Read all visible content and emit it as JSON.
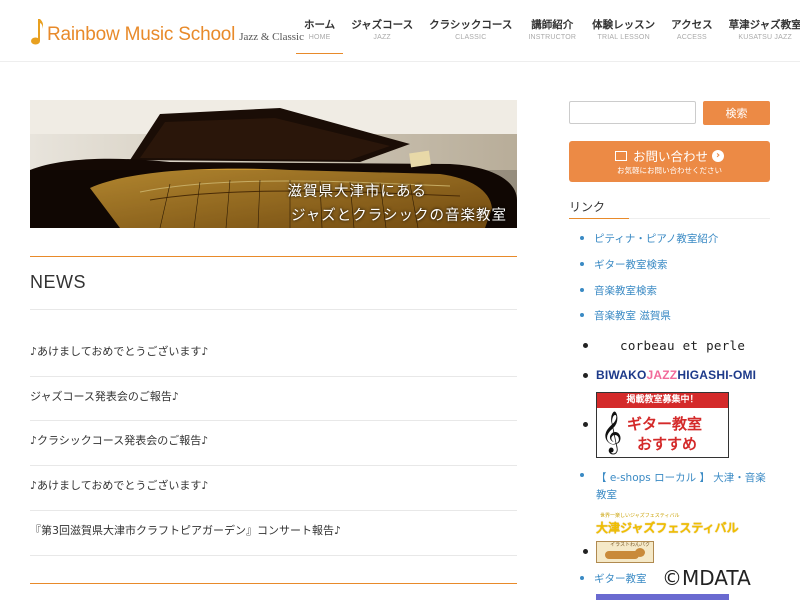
{
  "logo": {
    "main": "Rainbow Music School",
    "sub": "Jazz & Classic"
  },
  "nav": [
    {
      "jp": "ホーム",
      "en": "HOME",
      "active": true
    },
    {
      "jp": "ジャズコース",
      "en": "JAZZ"
    },
    {
      "jp": "クラシックコース",
      "en": "CLASSIC"
    },
    {
      "jp": "講師紹介",
      "en": "INSTRUCTOR"
    },
    {
      "jp": "体験レッスン",
      "en": "TRIAL LESSON"
    },
    {
      "jp": "アクセス",
      "en": "ACCESS"
    },
    {
      "jp": "草津ジャズ教室",
      "en": "KUSATSU JAZZ"
    }
  ],
  "hero": {
    "line1": "滋賀県大津市にある",
    "line2": "ジャズとクラシックの音楽教室"
  },
  "news": {
    "title": "NEWS",
    "items": [
      "♪あけましておめでとうございます♪",
      "ジャズコース発表会のご報告♪",
      "♪クラシックコース発表会のご報告♪",
      "♪あけましておめでとうございます♪",
      "『第3回滋賀県大津市クラフトピアガーデン』コンサート報告♪"
    ]
  },
  "sidebar": {
    "search_placeholder": "",
    "search_button": "検索",
    "contact_main": "お問い合わせ",
    "contact_sub": "お気軽にお問い合わせください",
    "links_title": "リンク",
    "links": [
      "ピティナ・ピアノ教室紹介",
      "ギター教室検索",
      "音楽教室検索",
      "音楽教室 滋賀県"
    ],
    "corbeau": "corbeau et perle",
    "biwako_a": "BIWAKO",
    "biwako_b": "JAZZ",
    "biwako_c": "HIGASHI-OMI",
    "guitar_banner_top": "掲載教室募集中！",
    "guitar_banner_l1": "ギター教室",
    "guitar_banner_l2": "おすすめ",
    "eshops": "【 e-shops ローカル 】 大津・音楽教室",
    "fest_top": "世界一楽しいジャズフェスティバル",
    "fest_main": "大津ジャズフェスティバル",
    "dog_top": "イラストわんパク",
    "guitar_link2": "ギター教室"
  },
  "watermark": "©MDATA",
  "colors": {
    "accent": "#ec8a45",
    "link": "#3a8ac4",
    "logo": "#e88a2a"
  }
}
